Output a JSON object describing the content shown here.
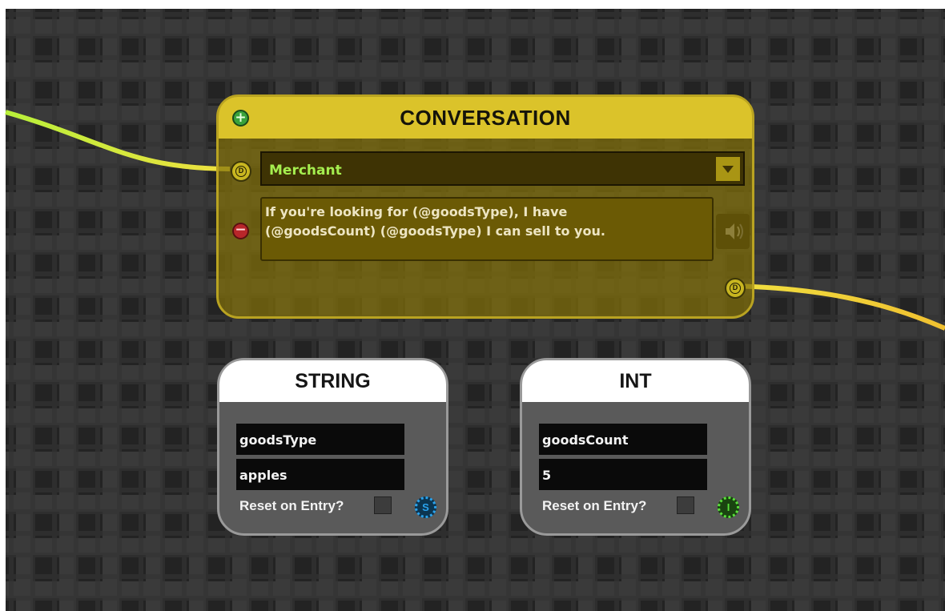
{
  "conversation_node": {
    "title": "CONVERSATION",
    "speaker": "Merchant",
    "dialogue": "If you're looking for (@goodsType), I have\n(@goodsCount) (@goodsType) I can sell to you.",
    "port_label": "D",
    "icons": {
      "add": "plus-icon",
      "remove": "minus-icon",
      "dropdown": "chevron-down-icon",
      "audio": "speaker-icon"
    },
    "colors": {
      "header": "#dbc32a",
      "body": "#82700a",
      "border": "#b9a321",
      "speaker_text": "#a5ee4f"
    }
  },
  "string_node": {
    "title": "STRING",
    "name": "goodsType",
    "value": "apples",
    "reset_label": "Reset on Entry?",
    "reset_checked": false,
    "badge": "S",
    "badge_color": "#2aa3ee"
  },
  "int_node": {
    "title": "INT",
    "name": "goodsCount",
    "value": "5",
    "reset_label": "Reset on Entry?",
    "reset_checked": false,
    "badge": "I",
    "badge_color": "#59e23a"
  },
  "canvas": {
    "background": "#232323",
    "wire_colors": [
      "#c8f03a",
      "#f0d040"
    ]
  }
}
